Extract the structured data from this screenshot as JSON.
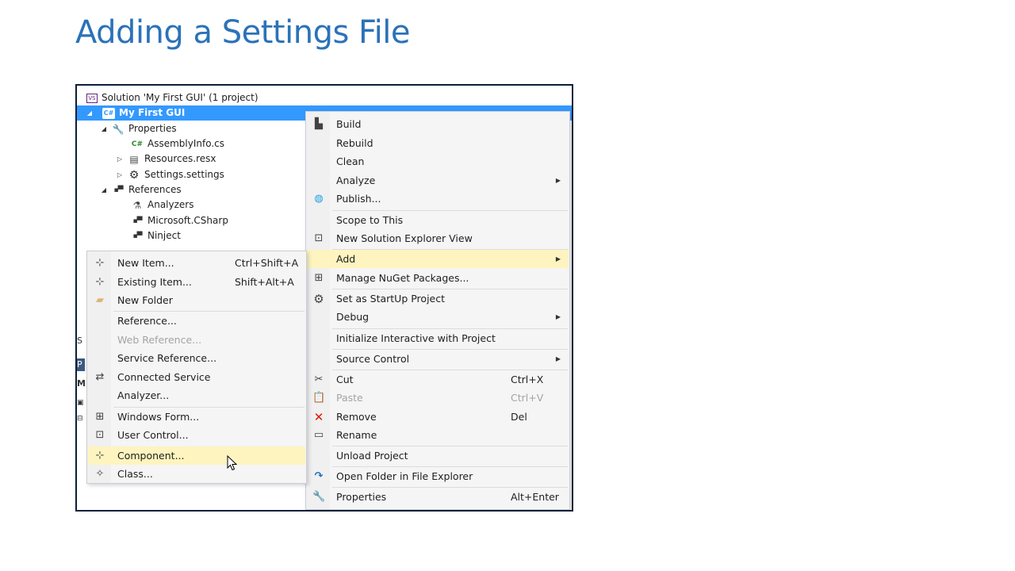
{
  "slide": {
    "title": "Adding a Settings File"
  },
  "colors": {
    "title": "#2b72b9",
    "selection": "#3399ff",
    "highlight": "#fdf4bf",
    "frame": "#0b1f3a",
    "remove_icon": "#e51400",
    "publish_icon": "#1ba1e2"
  },
  "solution_explorer": {
    "solution": "Solution 'My First GUI' (1 project)",
    "project": "My First GUI",
    "project_icon_text": "C#",
    "cs_icon_text": "C#",
    "items": {
      "properties": "Properties",
      "assembly_info": "AssemblyInfo.cs",
      "resources": "Resources.resx",
      "settings": "Settings.settings",
      "references": "References",
      "analyzers": "Analyzers",
      "microsoft_csharp": "Microsoft.CSharp",
      "ninject": "Ninject"
    },
    "left_clipped_chars": [
      "S",
      "P",
      "M"
    ]
  },
  "context_menu": {
    "build": "Build",
    "rebuild": "Rebuild",
    "clean": "Clean",
    "analyze": "Analyze",
    "publish": "Publish...",
    "scope_to_this": "Scope to This",
    "new_solution_explorer_view": "New Solution Explorer View",
    "add": "Add",
    "manage_nuget": "Manage NuGet Packages...",
    "set_startup": "Set as StartUp Project",
    "debug": "Debug",
    "initialize_interactive": "Initialize Interactive with Project",
    "source_control": "Source Control",
    "cut": "Cut",
    "cut_shortcut": "Ctrl+X",
    "paste": "Paste",
    "paste_shortcut": "Ctrl+V",
    "remove": "Remove",
    "remove_shortcut": "Del",
    "rename": "Rename",
    "unload_project": "Unload Project",
    "open_folder": "Open Folder in File Explorer",
    "properties": "Properties",
    "properties_shortcut": "Alt+Enter"
  },
  "add_submenu": {
    "new_item": "New Item...",
    "new_item_shortcut": "Ctrl+Shift+A",
    "existing_item": "Existing Item...",
    "existing_item_shortcut": "Shift+Alt+A",
    "new_folder": "New Folder",
    "reference": "Reference...",
    "web_reference": "Web Reference...",
    "service_reference": "Service Reference...",
    "connected_service": "Connected Service",
    "analyzer": "Analyzer...",
    "windows_form": "Windows Form...",
    "user_control": "User Control...",
    "component": "Component...",
    "class": "Class..."
  }
}
